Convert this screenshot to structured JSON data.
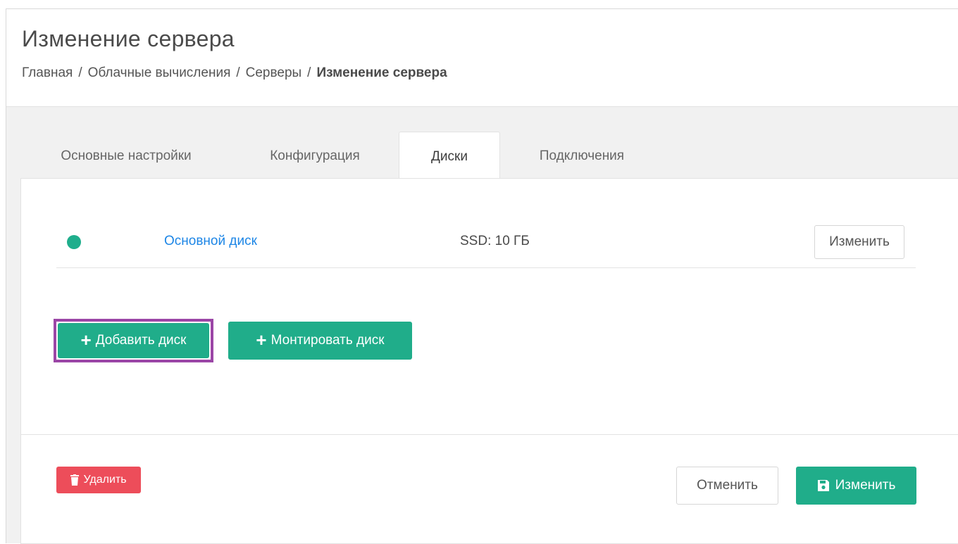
{
  "header": {
    "title": "Изменение сервера",
    "breadcrumb": [
      "Главная",
      "Облачные вычисления",
      "Серверы",
      "Изменение сервера"
    ],
    "breadcrumb_separator": "/"
  },
  "tabs": [
    {
      "label": "Основные настройки",
      "active": false
    },
    {
      "label": "Конфигурация",
      "active": false
    },
    {
      "label": "Диски",
      "active": true
    },
    {
      "label": "Подключения",
      "active": false
    }
  ],
  "disks": [
    {
      "name": "Основной диск",
      "size": "SSD: 10 ГБ",
      "status_color": "#1fae8c",
      "edit_label": "Изменить"
    }
  ],
  "actions": {
    "add_disk_label": "Добавить диск",
    "mount_disk_label": "Монтировать диск",
    "plus_icon": "+"
  },
  "footer": {
    "delete_label": "Удалить",
    "cancel_label": "Отменить",
    "save_label": "Изменить"
  },
  "colors": {
    "accent_green": "#20ad8a",
    "danger_red": "#ed4d5a",
    "link_blue": "#1d86e6",
    "highlight_purple": "#9b46a6"
  }
}
